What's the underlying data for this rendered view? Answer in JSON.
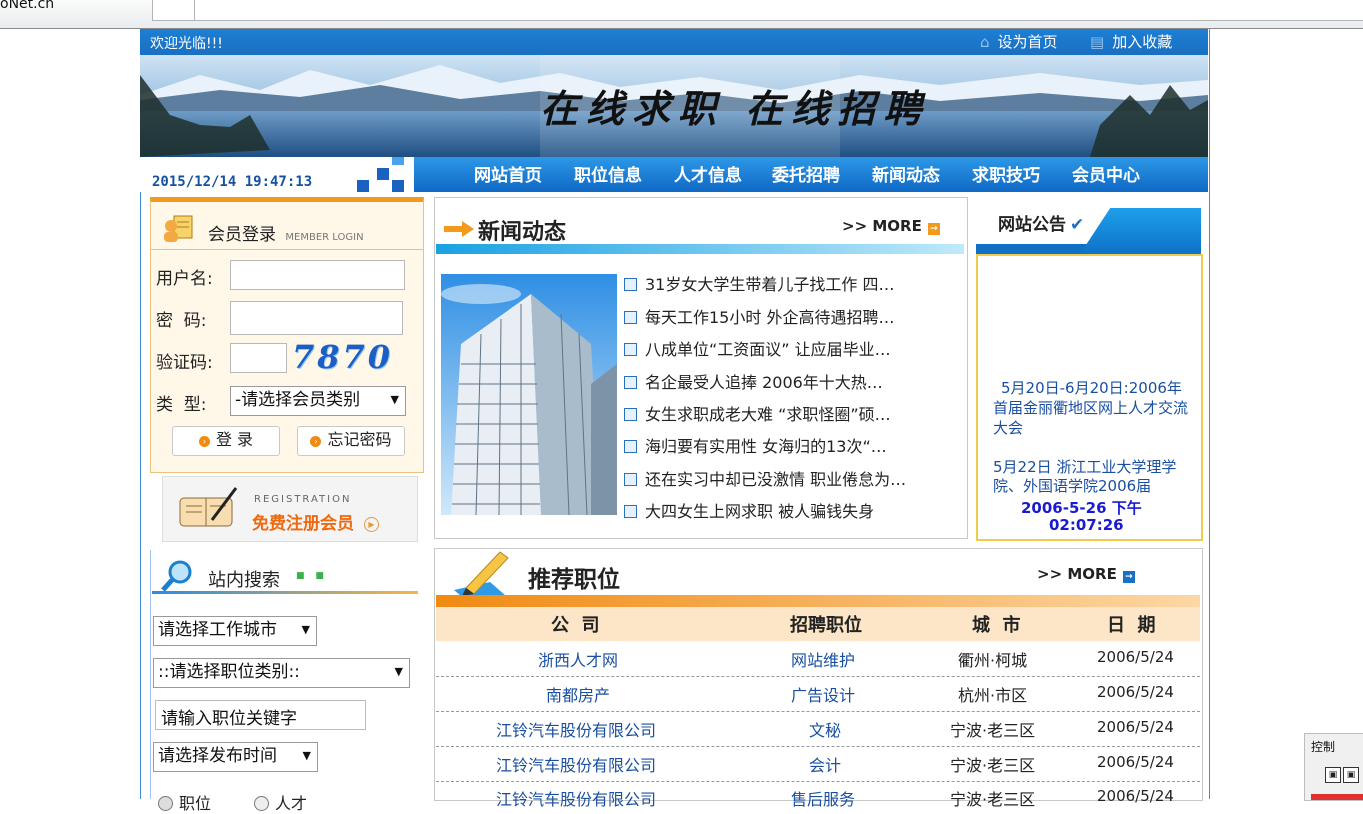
{
  "browser": {
    "tab_fragment": "oNet.cn"
  },
  "header": {
    "welcome": "欢迎光临!!!",
    "set_home": "设为首页",
    "add_favorite": "加入收藏",
    "banner_title": "在线求职  在线招聘"
  },
  "clock": "2015/12/14 19:47:13",
  "nav": [
    "网站首页",
    "职位信息",
    "人才信息",
    "委托招聘",
    "新闻动态",
    "求职技巧",
    "会员中心"
  ],
  "login": {
    "title": "会员登录",
    "subtitle": "MEMBER LOGIN",
    "username_label": "用户名:",
    "password_label": "密  码:",
    "captcha_label": "验证码:",
    "captcha_code": "7870",
    "type_label": "类  型:",
    "type_value": "-请选择会员类别",
    "login_button": "登 录",
    "forgot_button": "忘记密码"
  },
  "register": {
    "small": "REGISTRATION",
    "label": "免费注册会员"
  },
  "search": {
    "title": "站内搜索",
    "city": "请选择工作城市",
    "category": "::请选择职位类别::",
    "keyword_placeholder": "请输入职位关键字",
    "time": "请选择发布时间",
    "radio_1": "职位",
    "radio_2": "人才"
  },
  "news": {
    "title": "新闻动态",
    "more": ">> MORE",
    "items": [
      "31岁女大学生带着儿子找工作 四…",
      "每天工作15小时 外企高待遇招聘…",
      "八成单位“工资面议” 让应届毕业…",
      "名企最受人追捧 2006年十大热…",
      "女生求职成老大难 “求职怪圈”硕…",
      "海归要有实用性 女海归的13次“…",
      "还在实习中却已没激情 职业倦怠为…",
      "大四女生上网求职 被人骗钱失身"
    ]
  },
  "notice": {
    "title": "网站公告",
    "item1": "5月20日-6月20日:2006年首届金丽衢地区网上人才交流大会",
    "item2": "5月22日 浙江工业大学理学院、外国语学院2006届",
    "date": "2006-5-26 下午",
    "time": "02:07:26"
  },
  "jobs": {
    "title": "推荐职位",
    "more": ">> MORE",
    "headers": [
      "公  司",
      "招聘职位",
      "城  市",
      "日  期"
    ],
    "rows": [
      [
        "浙西人才网",
        "网站维护",
        "衢州·柯城",
        "2006/5/24"
      ],
      [
        "南都房产",
        "广告设计",
        "杭州·市区",
        "2006/5/24"
      ],
      [
        "江铃汽车股份有限公司",
        "文秘",
        "宁波·老三区",
        "2006/5/24"
      ],
      [
        "江铃汽车股份有限公司",
        "会计",
        "宁波·老三区",
        "2006/5/24"
      ],
      [
        "江铃汽车股份有限公司",
        "售后服务",
        "宁波·老三区",
        "2006/5/24"
      ]
    ]
  },
  "widget": {
    "label": "控制"
  },
  "colors": {
    "nav_blue": "#1a7ad6",
    "orange": "#f39a1d",
    "link_blue": "#1a4fa0"
  }
}
